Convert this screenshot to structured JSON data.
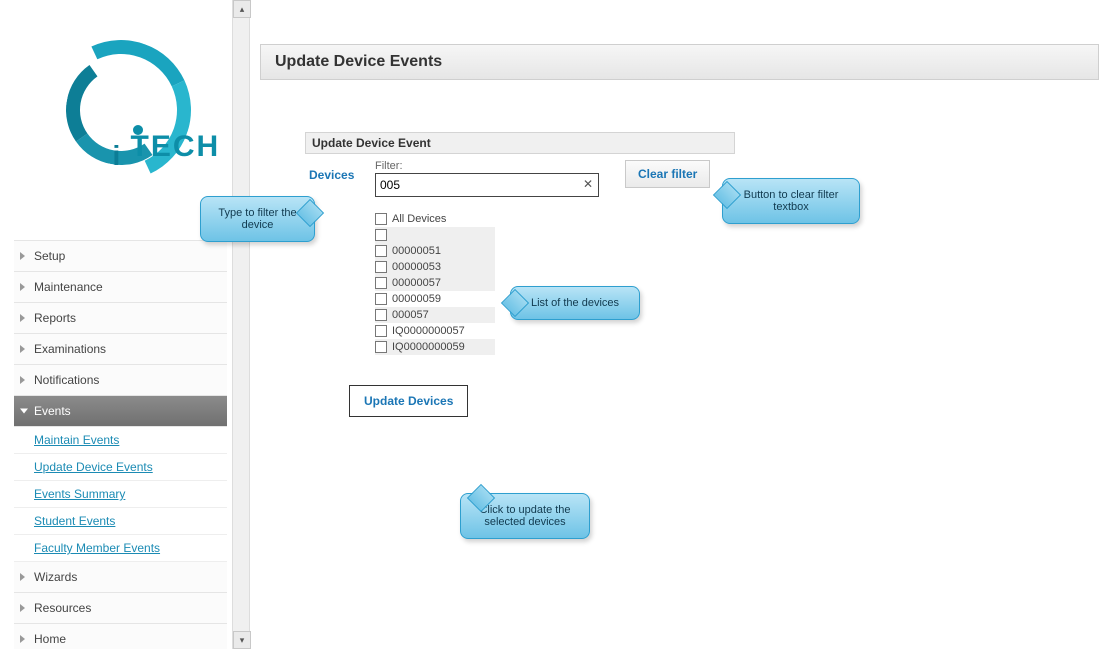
{
  "logo": {
    "text": "TECH"
  },
  "sidebar": {
    "items": [
      {
        "label": "Setup",
        "expanded": false
      },
      {
        "label": "Maintenance",
        "expanded": false
      },
      {
        "label": "Reports",
        "expanded": false
      },
      {
        "label": "Examinations",
        "expanded": false
      },
      {
        "label": "Notifications",
        "expanded": false
      },
      {
        "label": "Events",
        "expanded": true
      },
      {
        "label": "Wizards",
        "expanded": false
      },
      {
        "label": "Resources",
        "expanded": false
      },
      {
        "label": "Home",
        "expanded": false
      }
    ],
    "events_subitems": [
      "Maintain Events",
      "Update Device Events",
      "Events Summary",
      "Student Events",
      "Faculty Member Events"
    ]
  },
  "page": {
    "title": "Update Device Events"
  },
  "panel": {
    "title": "Update Device Event",
    "devices_label": "Devices",
    "filter_label": "Filter:",
    "filter_value": "005",
    "clear_filter": "Clear filter",
    "all_devices_label": "All Devices",
    "devices": [
      {
        "label": "",
        "shaded": true
      },
      {
        "label": "00000051",
        "shaded": true
      },
      {
        "label": "00000053",
        "shaded": true
      },
      {
        "label": "00000057",
        "shaded": true
      },
      {
        "label": "00000059",
        "shaded": false
      },
      {
        "label": "000057",
        "shaded": true
      },
      {
        "label": "IQ0000000057",
        "shaded": false
      },
      {
        "label": "IQ0000000059",
        "shaded": true
      }
    ],
    "update_button": "Update Devices"
  },
  "callouts": {
    "filter_help": "Type to filter the device",
    "clear_help": "Button to clear filter textbox",
    "list_help": "List of the devices",
    "update_help": "Click to update the selected devices"
  }
}
